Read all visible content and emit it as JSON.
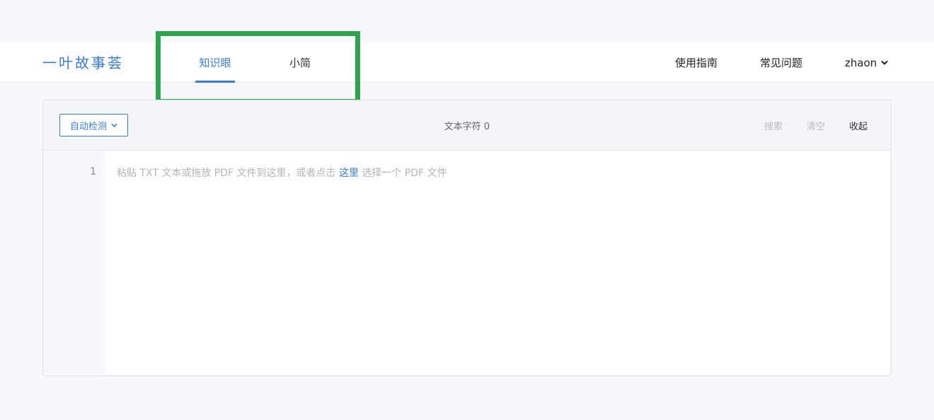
{
  "header": {
    "logo": "一叶故事荟",
    "tabs": [
      {
        "label": "知识眼",
        "active": true
      },
      {
        "label": "小简",
        "active": false
      }
    ],
    "links": {
      "guide": "使用指南",
      "faq": "常见问题"
    },
    "user": {
      "name": "zhaon",
      "icon": "chevron-down-icon"
    }
  },
  "editor": {
    "detect_label": "自动检测",
    "char_count": "文本字符 0",
    "actions": {
      "search": "搜索",
      "clear": "清空",
      "collapse": "收起"
    },
    "line_number": "1",
    "placeholder_prefix": "粘贴 TXT 文本或拖放 PDF 文件到这里，或者点击",
    "placeholder_link": "这里",
    "placeholder_suffix": "选择一个 PDF 文件"
  },
  "colors": {
    "accent": "#3a7bd5",
    "highlight": "#2ea44f",
    "background": "#f7f8fc"
  }
}
